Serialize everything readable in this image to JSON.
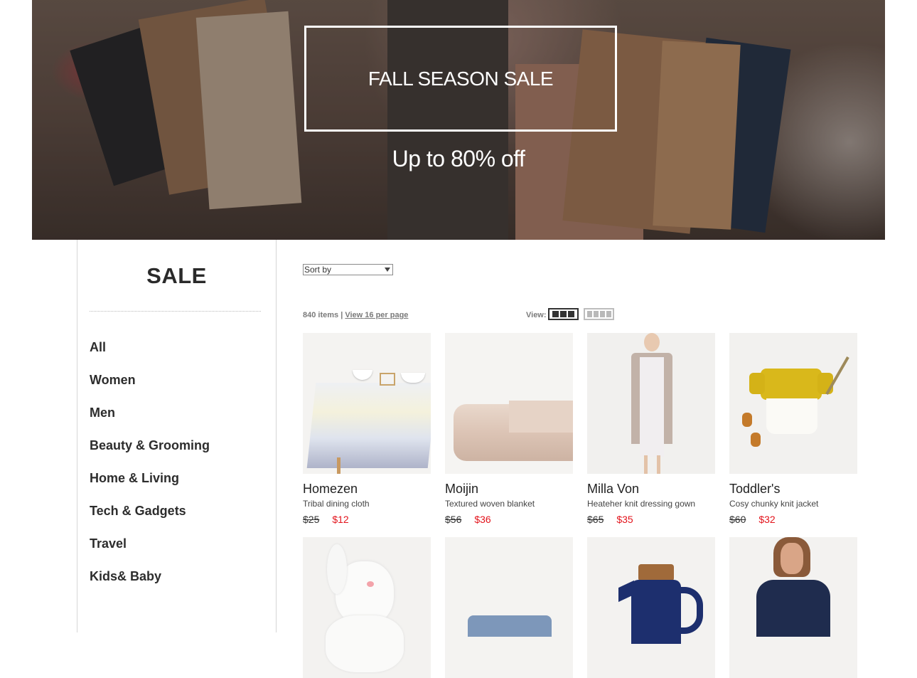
{
  "hero": {
    "title": "FALL SEASON SALE",
    "subtitle": "Up to 80% off"
  },
  "sidebar": {
    "heading": "SALE",
    "categories": [
      "All",
      "Women",
      "Men",
      "Beauty & Grooming",
      "Home & Living",
      "Tech & Gadgets",
      "Travel",
      "Kids& Baby"
    ]
  },
  "toolbar": {
    "sort_label": "Sort by",
    "items_count": "840 items",
    "separator": " | ",
    "per_page_link": "View 16 per page",
    "view_label": "View:"
  },
  "products": [
    {
      "brand": "Homezen",
      "desc": "Tribal dining cloth",
      "old_price": "$25",
      "new_price": "$12"
    },
    {
      "brand": "Moijin",
      "desc": "Textured woven blanket",
      "old_price": "$56",
      "new_price": "$36"
    },
    {
      "brand": "Milla Von",
      "desc": "Heateher knit dressing gown",
      "old_price": "$65",
      "new_price": "$35"
    },
    {
      "brand": "Toddler's",
      "desc": "Cosy chunky knit jacket",
      "old_price": "$60",
      "new_price": "$32"
    }
  ],
  "colors": {
    "sale_price": "#e3141c",
    "text": "#222222",
    "border": "#d6d6d6"
  }
}
